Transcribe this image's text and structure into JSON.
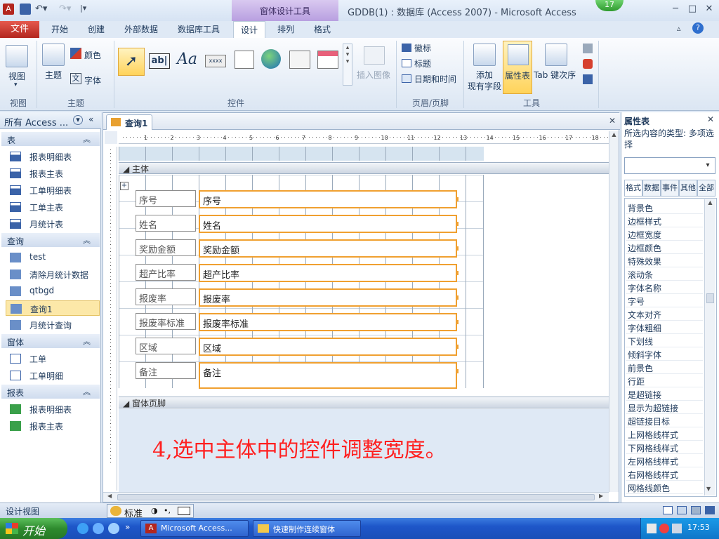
{
  "window": {
    "title": "GDDB(1) : 数据库 (Access 2007)  -  Microsoft Access",
    "context_tools": "窗体设计工具",
    "badge": "17",
    "controls": [
      "─",
      "□",
      "✕"
    ]
  },
  "tabs": {
    "file": "文件",
    "items": [
      "开始",
      "创建",
      "外部数据",
      "数据库工具",
      "设计",
      "排列",
      "格式"
    ],
    "active": "设计"
  },
  "ribbon": {
    "groups": {
      "view": "视图",
      "theme": "主题",
      "controls": "控件",
      "header_footer": "页眉/页脚",
      "tools": "工具"
    },
    "view_button": "视图",
    "theme_button": "主题",
    "colors_button": "颜色",
    "fonts_button": "字体",
    "insert_image": "插入图像",
    "logo": "徽标",
    "title": "标题",
    "date_time": "日期和时间",
    "add_fields_line1": "添加",
    "add_fields_line2": "现有字段",
    "property_sheet": "属性表",
    "tab_order": "Tab 键次序"
  },
  "nav": {
    "header": "所有 Access ...",
    "groups": [
      {
        "name": "表",
        "items": [
          "报表明细表",
          "报表主表",
          "工单明细表",
          "工单主表",
          "月统计表"
        ]
      },
      {
        "name": "查询",
        "items": [
          "test",
          "清除月统计数据",
          "qtbgd",
          "查询1",
          "月统计查询"
        ]
      },
      {
        "name": "窗体",
        "items": [
          "工单",
          "工单明细"
        ]
      },
      {
        "name": "报表",
        "items": [
          "报表明细表",
          "报表主表"
        ]
      }
    ],
    "selected": "查询1"
  },
  "doc": {
    "tab": "查询1",
    "section_body": "主体",
    "section_footer": "窗体页脚",
    "fields": [
      {
        "label": "序号",
        "control": "序号"
      },
      {
        "label": "姓名",
        "control": "姓名"
      },
      {
        "label": "奖励金额",
        "control": "奖励金额"
      },
      {
        "label": "超产比率",
        "control": "超产比率"
      },
      {
        "label": "报废率",
        "control": "报废率"
      },
      {
        "label": "报废率标准",
        "control": "报废率标准"
      },
      {
        "label": "区域",
        "control": "区域"
      },
      {
        "label": "备注",
        "control": "备注"
      }
    ],
    "instruction": "4,选中主体中的控件调整宽度。",
    "ruler_numbers": [
      "1",
      "2",
      "3",
      "4",
      "5",
      "6",
      "7",
      "8",
      "9",
      "10",
      "11",
      "12",
      "13",
      "14",
      "15",
      "16",
      "17",
      "18"
    ]
  },
  "props": {
    "title": "属性表",
    "selection_type": "所选内容的类型:  多项选择",
    "tabs": [
      "格式",
      "数据",
      "事件",
      "其他",
      "全部"
    ],
    "items": [
      "背景色",
      "边框样式",
      "边框宽度",
      "边框颜色",
      "特殊效果",
      "滚动条",
      "字体名称",
      "字号",
      "文本对齐",
      "字体粗细",
      "下划线",
      "倾斜字体",
      "前景色",
      "行距",
      "是超链接",
      "显示为超链接",
      "超链接目标",
      "上网格线样式",
      "下网格线样式",
      "左网格线样式",
      "右网格线样式",
      "网格线颜色"
    ]
  },
  "status": {
    "text": "设计视图",
    "ime": "标准"
  },
  "taskbar": {
    "start": "开始",
    "tasks": [
      "Microsoft Access...",
      "快速制作连续窗体"
    ],
    "clock": "17:53"
  }
}
